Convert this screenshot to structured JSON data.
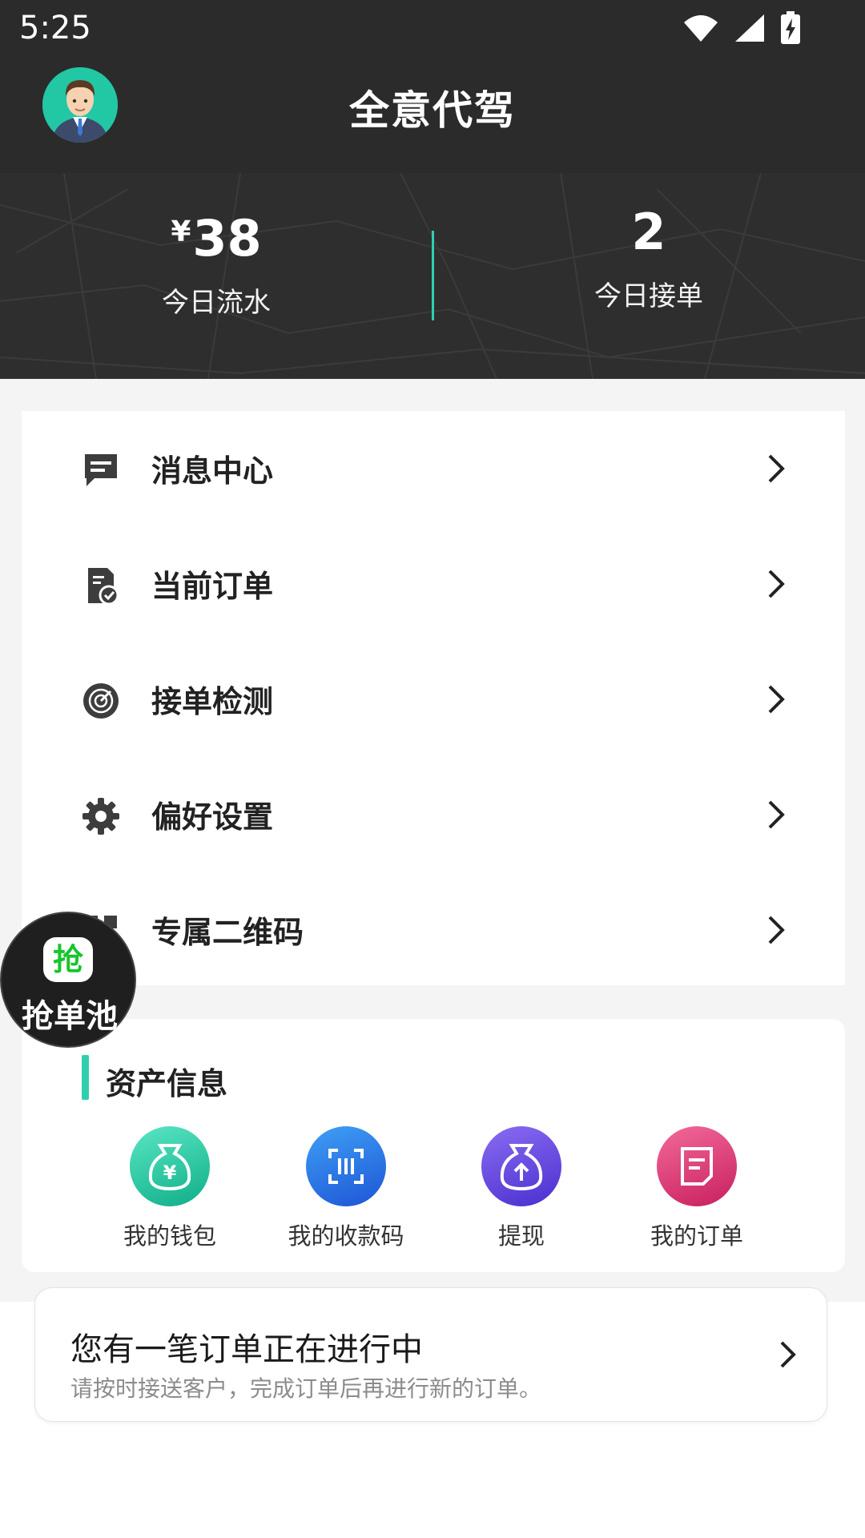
{
  "status_bar": {
    "time": "5:25"
  },
  "header": {
    "title": "全意代驾"
  },
  "stats": {
    "currency_symbol": "¥",
    "revenue_value": "38",
    "revenue_label": "今日流水",
    "orders_value": "2",
    "orders_label": "今日接单"
  },
  "menu": {
    "items": [
      {
        "label": "消息中心",
        "icon": "message-icon"
      },
      {
        "label": "当前订单",
        "icon": "order-check-icon"
      },
      {
        "label": "接单检测",
        "icon": "radar-icon"
      },
      {
        "label": "偏好设置",
        "icon": "gear-icon"
      },
      {
        "label": "专属二维码",
        "icon": "qrcode-icon"
      }
    ]
  },
  "floating_button": {
    "badge": "抢",
    "label": "抢单池"
  },
  "assets": {
    "title": "资产信息",
    "items": [
      {
        "label": "我的钱包",
        "icon": "wallet-icon",
        "color": "#1fc9a0"
      },
      {
        "label": "我的收款码",
        "icon": "scan-code-icon",
        "color": "#2a7fe6"
      },
      {
        "label": "提现",
        "icon": "withdraw-icon",
        "color": "#6b4de0"
      },
      {
        "label": "我的订单",
        "icon": "order-icon",
        "color": "#e8417a"
      }
    ]
  },
  "notice": {
    "title": "您有一笔订单正在进行中",
    "subtitle": "请按时接送客户，完成订单后再进行新的订单。"
  },
  "colors": {
    "accent": "#2fcfae",
    "header_bg": "#2b2b2b"
  }
}
